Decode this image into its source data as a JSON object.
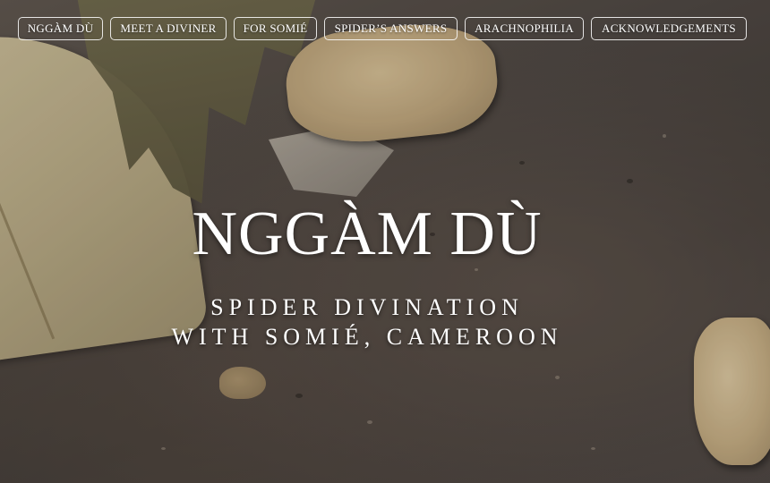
{
  "nav": {
    "items": [
      {
        "label": "NGGÀM DÙ"
      },
      {
        "label": "MEET A DIVINER"
      },
      {
        "label": "FOR SOMIÉ"
      },
      {
        "label": "SPIDER’S ANSWERS"
      },
      {
        "label": "ARACHNOPHILIA"
      },
      {
        "label": "ACKNOWLEDGEMENTS"
      }
    ]
  },
  "hero": {
    "title": "NGGÀM DÙ",
    "subtitle_line1": "SPIDER DIVINATION",
    "subtitle_line2": "WITH SOMIÉ, CAMEROON"
  },
  "colors": {
    "text": "#ffffff",
    "ground": "#4a4440",
    "leaf": "#c9bd98",
    "rock": "#d2bd93"
  }
}
